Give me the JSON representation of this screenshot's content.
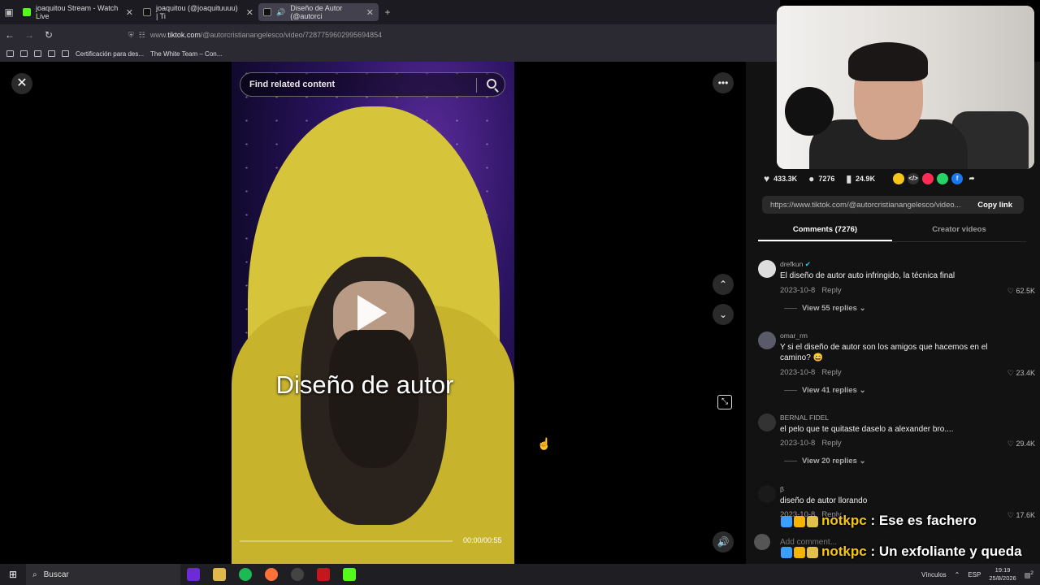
{
  "browser": {
    "tabs": [
      {
        "label": "joaquitou Stream - Watch Live",
        "color": "#53fc18"
      },
      {
        "label": "joaquitou (@joaquituuuu) | Ti",
        "color": "#111111"
      },
      {
        "label": "Diseño de Autor (@autorci",
        "color": "#111111"
      }
    ],
    "url_prefix": "www.",
    "url_host": "tiktok.com",
    "url_path": "/@autorcristianangelesco/video/7287759602995694854",
    "bookmarks": [
      "Certificación para des...",
      "The White Team – Con..."
    ]
  },
  "video": {
    "search_placeholder": "Find related content",
    "caption": "Diseño de autor",
    "time": "00:00/00:55",
    "progress": 0.0
  },
  "stats": {
    "likes": "433.3K",
    "comments": "7276",
    "saves": "24.9K"
  },
  "share": {
    "link": "https://www.tiktok.com/@autorcristianangelesco/video...",
    "copy_label": "Copy link"
  },
  "tabs": {
    "comments": "Comments (7276)",
    "creator": "Creator videos"
  },
  "comments": [
    {
      "user": "drefkun",
      "text": "El diseño de autor auto infringido, la técnica final",
      "date": "2023-10-8",
      "reply": "Reply",
      "likes": "62.5K",
      "replies": "View 55 replies"
    },
    {
      "user": "omar_rm",
      "text": "Y si el diseño de autor son los amigos que hacemos en el camino? 😄",
      "date": "2023-10-8",
      "reply": "Reply",
      "likes": "23.4K",
      "replies": "View 41 replies"
    },
    {
      "user": "BERNAL FIDEL",
      "text": "el pelo que te quitaste daselo a alexander bro....",
      "date": "2023-10-8",
      "reply": "Reply",
      "likes": "29.4K",
      "replies": "View 20 replies"
    },
    {
      "user": "β",
      "text": "diseño de autor llorando",
      "date": "2023-10-8",
      "reply": "Reply",
      "likes": "17.6K",
      "replies": ""
    }
  ],
  "add_comment_placeholder": "Add comment...",
  "chat": [
    {
      "user": "notkpc",
      "message": "Ese es fachero"
    },
    {
      "user": "notkpc",
      "message": "Un exfoliante y queda bien"
    }
  ],
  "taskbar": {
    "search": "Buscar",
    "links": "Vínculos",
    "lang": "ESP",
    "time": "19:19",
    "date": "25/8/2026",
    "notif": "2"
  }
}
